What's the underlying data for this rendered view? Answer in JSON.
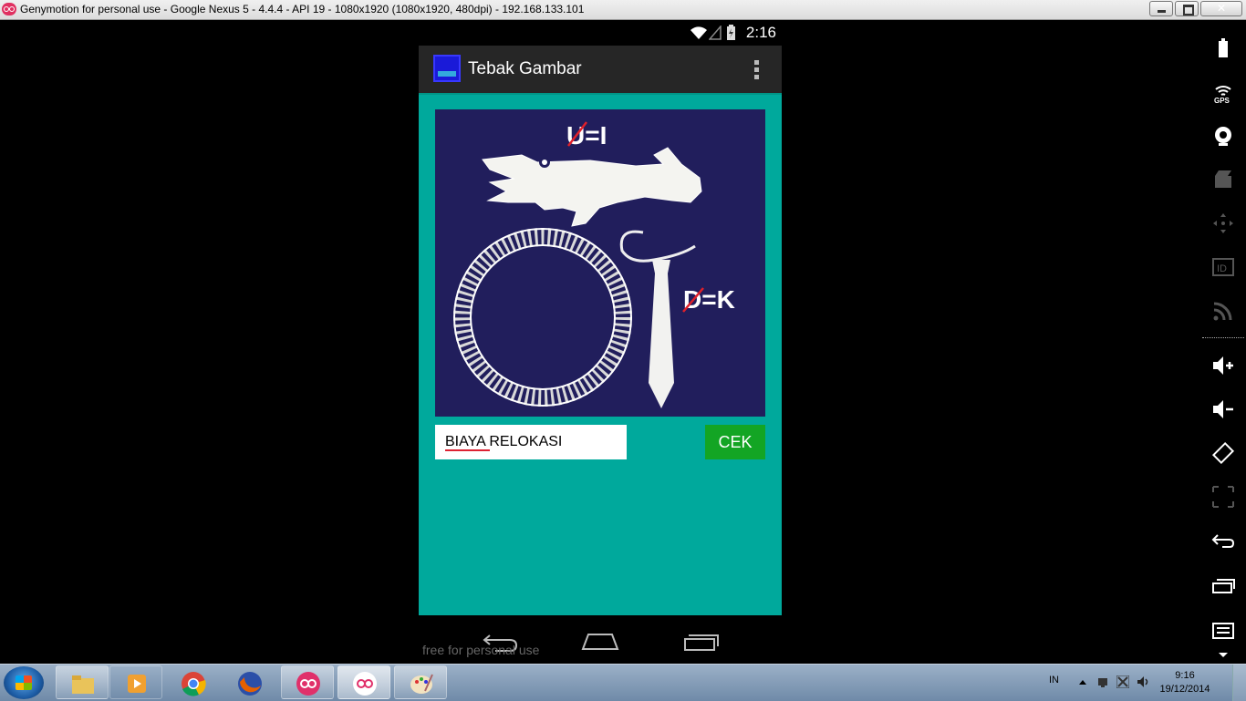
{
  "window": {
    "title": "Genymotion for personal use - Google Nexus 5 - 4.4.4 - API 19 - 1080x1920 (1080x1920, 480dpi) - 192.168.133.101"
  },
  "status_bar": {
    "time": "2:16"
  },
  "app": {
    "title": "Tebak Gambar",
    "puzzle_text_1": "U=I",
    "puzzle_text_2": "D=K",
    "answer_value": "BIAYA RELOKASI",
    "check_label": "CEK"
  },
  "emulator": {
    "watermark": "free for personal use"
  },
  "taskbar": {
    "language": "IN",
    "time": "9:16",
    "date": "19/12/2014"
  },
  "colors": {
    "app_background": "#00a99c",
    "puzzle_background": "#211e5c",
    "check_button": "#13a524",
    "action_bar": "#262626"
  }
}
